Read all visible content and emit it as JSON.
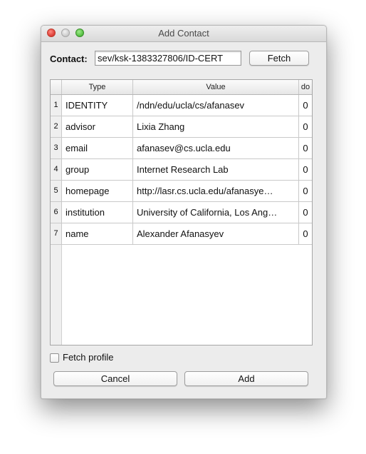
{
  "window": {
    "title": "Add Contact"
  },
  "contact": {
    "label": "Contact:",
    "value": "sev/ksk-1383327806/ID-CERT",
    "fetch_label": "Fetch"
  },
  "table": {
    "headers": {
      "type": "Type",
      "value": "Value",
      "trust": "do"
    },
    "rows": [
      {
        "num": "1",
        "type": "IDENTITY",
        "value": "/ndn/edu/ucla/cs/afanasev",
        "trust": "0"
      },
      {
        "num": "2",
        "type": "advisor",
        "value": "Lixia Zhang",
        "trust": "0"
      },
      {
        "num": "3",
        "type": "email",
        "value": "afanasev@cs.ucla.edu",
        "trust": "0"
      },
      {
        "num": "4",
        "type": "group",
        "value": "Internet Research Lab",
        "trust": "0"
      },
      {
        "num": "5",
        "type": "homepage",
        "value": "http://lasr.cs.ucla.edu/afanasye…",
        "trust": "0"
      },
      {
        "num": "6",
        "type": "institution",
        "value": "University of California, Los Ang…",
        "trust": "0"
      },
      {
        "num": "7",
        "type": "name",
        "value": "Alexander Afanasyev",
        "trust": "0"
      }
    ]
  },
  "fetch_profile": {
    "label": "Fetch profile",
    "checked": false
  },
  "buttons": {
    "cancel": "Cancel",
    "add": "Add"
  }
}
